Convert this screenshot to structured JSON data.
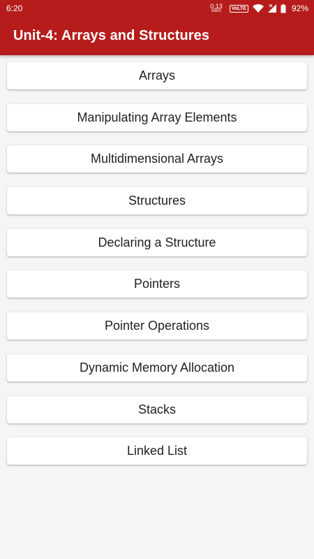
{
  "status_bar": {
    "time": "6:20",
    "net_speed_value": "0.13",
    "net_speed_unit": "KB/S",
    "volte": "VoLTE",
    "battery": "92%",
    "icons": [
      "wifi-icon",
      "signal-icon",
      "battery-icon"
    ]
  },
  "app_bar": {
    "title": "Unit-4: Arrays and Structures",
    "color": "#b71c1c"
  },
  "topics": [
    {
      "label": "Arrays"
    },
    {
      "label": "Manipulating Array Elements"
    },
    {
      "label": "Multidimensional Arrays"
    },
    {
      "label": "Structures"
    },
    {
      "label": "Declaring a Structure"
    },
    {
      "label": "Pointers"
    },
    {
      "label": "Pointer Operations"
    },
    {
      "label": "Dynamic Memory Allocation"
    },
    {
      "label": "Stacks"
    },
    {
      "label": "Linked List"
    }
  ]
}
